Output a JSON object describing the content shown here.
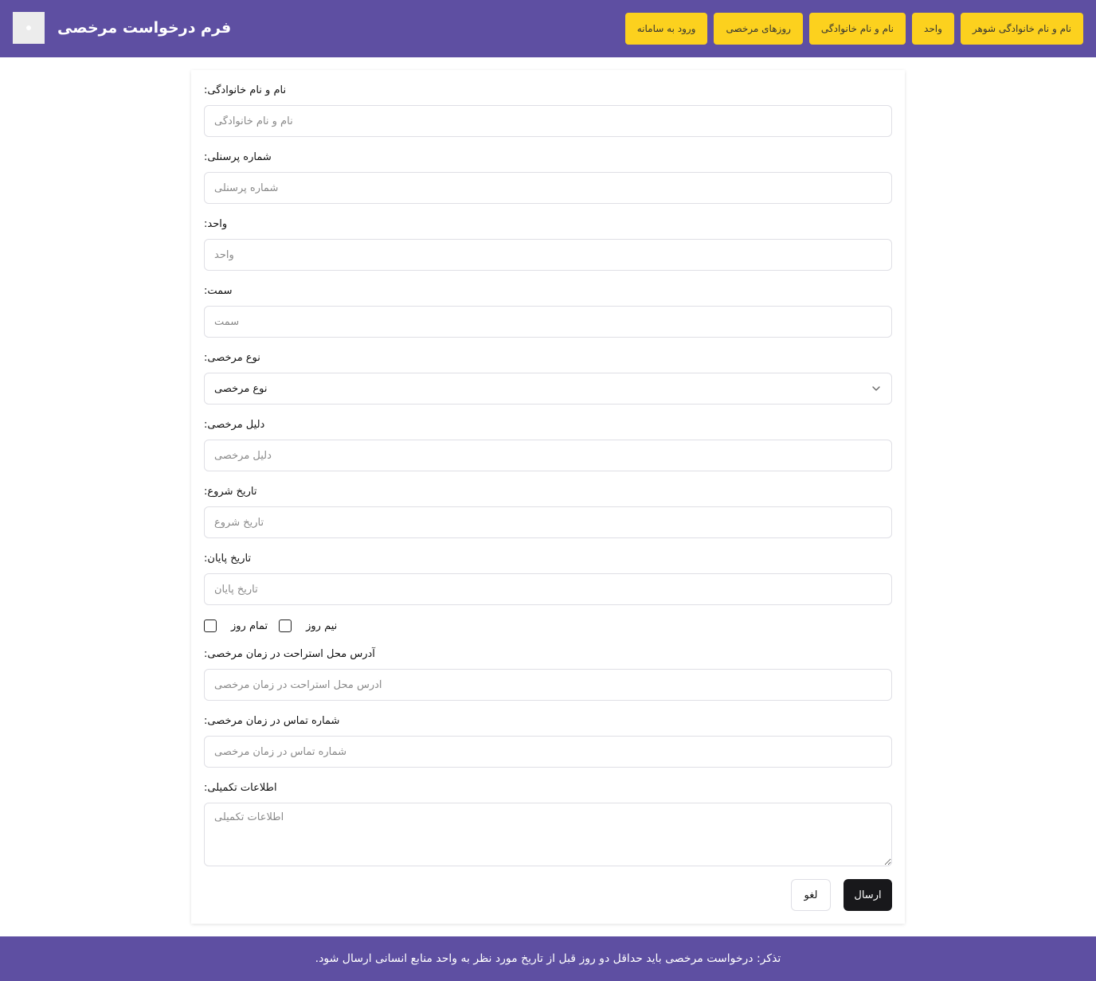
{
  "header": {
    "title": "فرم درخواست مرخصی",
    "nav": [
      "نام و نام خانوادگی شوهر",
      "واحد",
      "نام و نام خانوادگی",
      "روزهای مرخصی",
      "ورود به سامانه"
    ]
  },
  "form": {
    "full_name": {
      "label": ":نام و نام خانوادگی",
      "placeholder": "نام و نام خانوادگی"
    },
    "personnel_number": {
      "label": ":شماره پرسنلی",
      "placeholder": "شماره پرسنلی"
    },
    "unit": {
      "label": ":واحد",
      "placeholder": "واحد"
    },
    "position": {
      "label": ":سمت",
      "placeholder": "سمت"
    },
    "leave_type": {
      "label": ":نوع مرخصی",
      "value": "نوع مرخصی"
    },
    "leave_reason": {
      "label": ":دلیل مرخصی",
      "placeholder": "دلیل مرخصی"
    },
    "start_date": {
      "label": ":تاریخ شروع",
      "placeholder": "تاریخ شروع"
    },
    "end_date": {
      "label": ":تاریخ پایان",
      "placeholder": "تاریخ پایان"
    },
    "full_day": {
      "label": "تمام روز"
    },
    "half_day": {
      "label": "نیم روز"
    },
    "address": {
      "label": ":آدرس محل استراحت در زمان مرخصی",
      "placeholder": "آدرس محل استراحت در زمان مرخصی"
    },
    "contact": {
      "label": ":شماره تماس در زمان مرخصی",
      "placeholder": "شماره تماس در زمان مرخصی"
    },
    "additional_info": {
      "label": ":اطلاعات تکمیلی",
      "placeholder": "اطلاعات تکمیلی"
    },
    "submit_label": "ارسال",
    "cancel_label": "لغو"
  },
  "footer": {
    "note": ".تذکر: درخواست مرخصی باید حداقل دو روز قبل از تاریخ مورد نظر به واحد منابع انسانی ارسال شود"
  },
  "colors": {
    "header_bg": "#5e4fa2",
    "nav_button_bg": "#fcd11e",
    "submit_bg": "#18181b"
  }
}
